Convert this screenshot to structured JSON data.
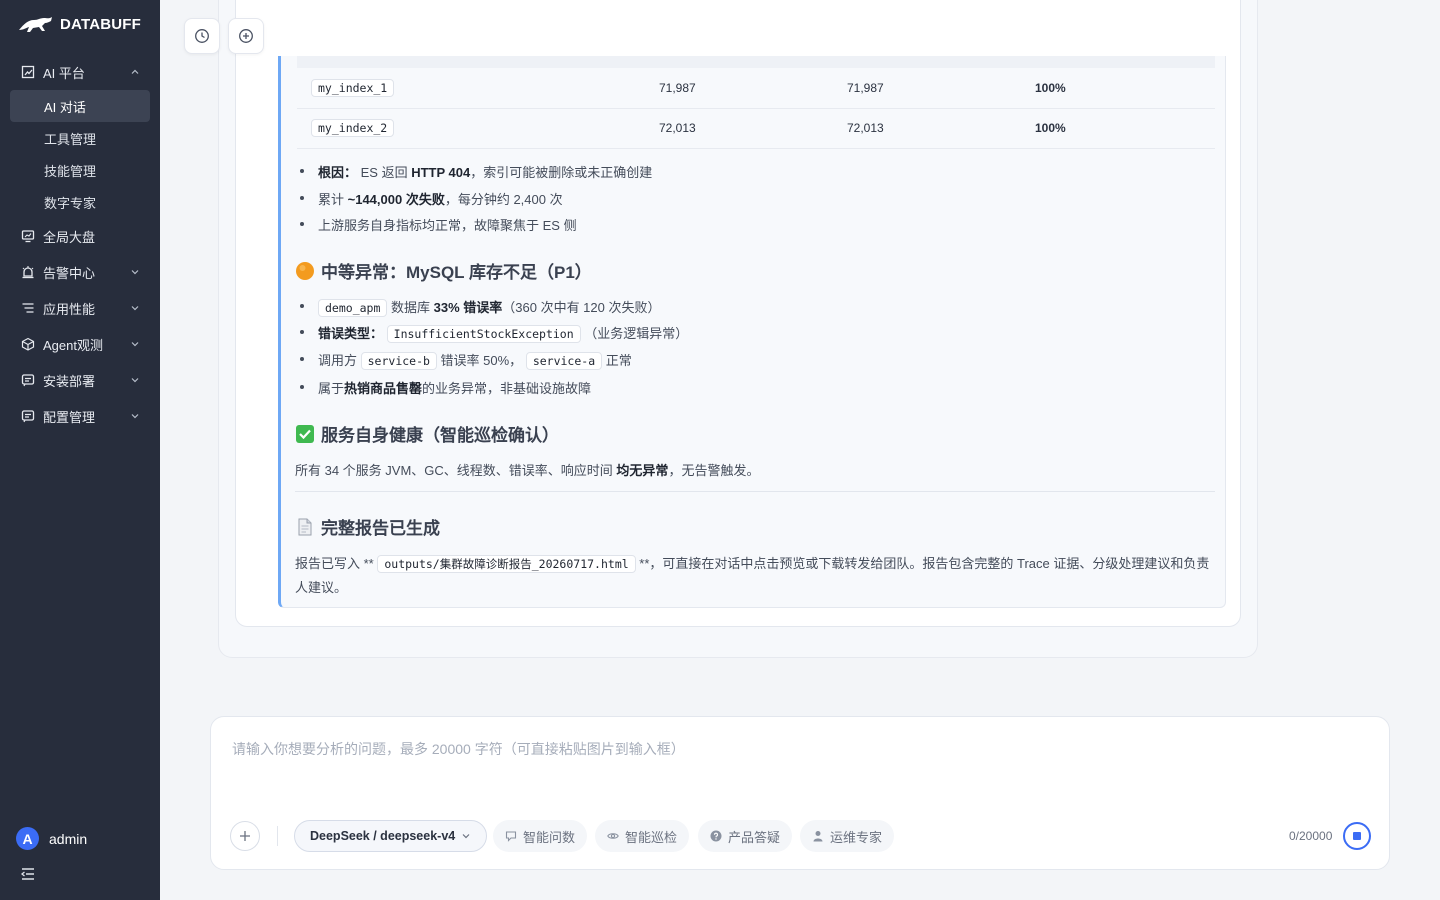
{
  "brand": {
    "name": "DATABUFF"
  },
  "sidebar": {
    "groups": [
      {
        "label": "AI 平台",
        "icon": "chart-icon",
        "expanded": true,
        "items": [
          {
            "label": "AI 对话",
            "active": true
          },
          {
            "label": "工具管理"
          },
          {
            "label": "技能管理"
          },
          {
            "label": "数字专家"
          }
        ]
      },
      {
        "label": "全局大盘",
        "icon": "dashboard-icon"
      },
      {
        "label": "告警中心",
        "icon": "alarm-icon"
      },
      {
        "label": "应用性能",
        "icon": "list-icon"
      },
      {
        "label": "Agent观测",
        "icon": "cube-icon"
      },
      {
        "label": "安装部署",
        "icon": "install-icon"
      },
      {
        "label": "配置管理",
        "icon": "config-icon"
      }
    ],
    "user": {
      "initial": "A",
      "name": "admin"
    }
  },
  "report": {
    "table_rows": [
      {
        "name": "my_index_1",
        "v1": "71,987",
        "v2": "71,987",
        "pct": "100%"
      },
      {
        "name": "my_index_2",
        "v1": "72,013",
        "v2": "72,013",
        "pct": "100%"
      }
    ],
    "es_bullets": {
      "b1_bold": "根因：",
      "b1_a": " ES 返回 ",
      "b1_bold2": "HTTP 404",
      "b1_b": "，索引可能被删除或未正确创建",
      "b2_a": "累计 ",
      "b2_bold": "~144,000 次失败",
      "b2_b": "，每分钟约 2,400 次",
      "b3": "上游服务自身指标均正常，故障聚焦于 ES 侧"
    },
    "mysql": {
      "heading": "中等异常：MySQL 库存不足（P1）",
      "b1_code": "demo_apm",
      "b1_a": " 数据库 ",
      "b1_bold": "33% 错误率",
      "b1_b": "（360 次中有 120 次失败）",
      "b2_bold": "错误类型：",
      "b2_code": "InsufficientStockException",
      "b2_b": "（业务逻辑异常）",
      "b3_a": "调用方 ",
      "b3_code1": "service-b",
      "b3_b": " 错误率 50%，",
      "b3_code2": "service-a",
      "b3_c": " 正常",
      "b4_a": "属于",
      "b4_bold": "热销商品售罄",
      "b4_b": "的业务异常，非基础设施故障"
    },
    "health": {
      "heading": "服务自身健康（智能巡检确认）",
      "text_a": "所有 34 个服务 JVM、GC、线程数、错误率、响应时间 ",
      "text_bold": "均无异常",
      "text_b": "，无告警触发。"
    },
    "final": {
      "heading": "完整报告已生成",
      "text_a": "报告已写入 ** ",
      "code": "outputs/集群故障诊断报告_20260717.html",
      "text_b": " **，可直接在对话中点击预览或下载转发给团队。报告包含完整的 Trace 证据、分级处理建议和负责",
      "text_c": "人建议。"
    }
  },
  "input": {
    "placeholder": "请输入你想要分析的问题，最多 20000 字符（可直接粘贴图片到输入框）",
    "model": "DeepSeek / deepseek-v4",
    "chips": [
      {
        "label": "智能问数",
        "icon": "chat-icon"
      },
      {
        "label": "智能巡检",
        "icon": "eye-icon"
      },
      {
        "label": "产品答疑",
        "icon": "help-icon"
      },
      {
        "label": "运维专家",
        "icon": "user-icon"
      }
    ],
    "counter": "0/20000"
  }
}
